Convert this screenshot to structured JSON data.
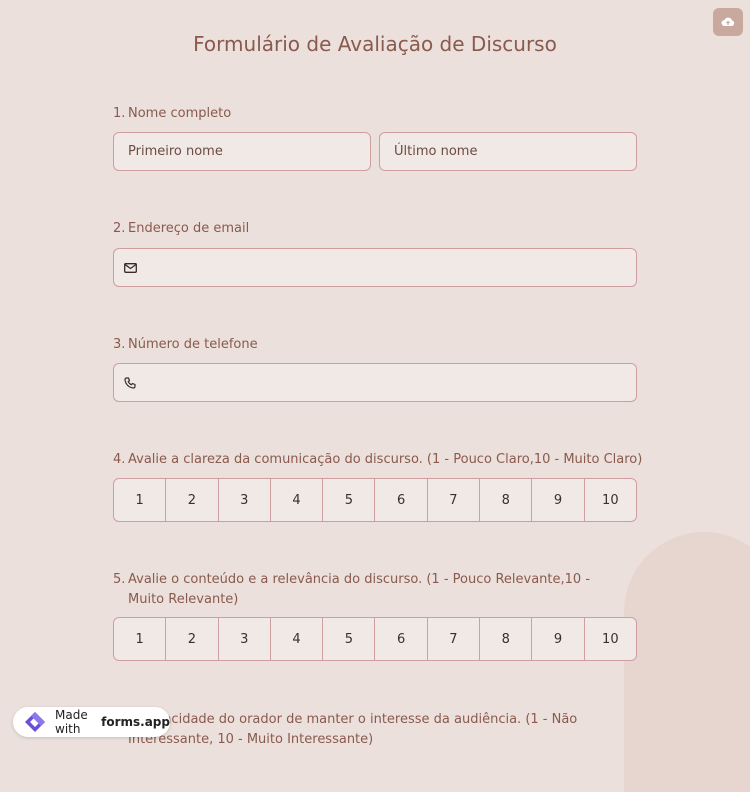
{
  "title": "Formulário de Avaliação de Discurso",
  "upload_icon": "cloud-upload-icon",
  "questions": {
    "q1": {
      "number": "1.",
      "label": "Nome completo",
      "first_placeholder": "Primeiro nome",
      "last_placeholder": "Último nome"
    },
    "q2": {
      "number": "2.",
      "label": "Endereço de email",
      "icon": "envelope-icon"
    },
    "q3": {
      "number": "3.",
      "label": "Número de telefone",
      "icon": "phone-icon"
    },
    "q4": {
      "number": "4.",
      "label": "Avalie a clareza da comunicação do discurso. (1 - Pouco Claro,10 - Muito Claro)",
      "options": [
        "1",
        "2",
        "3",
        "4",
        "5",
        "6",
        "7",
        "8",
        "9",
        "10"
      ]
    },
    "q5": {
      "number": "5.",
      "label": "Avalie o conteúdo e a relevância do discurso. (1 - Pouco Relevante,10 - Muito Relevante)",
      "options": [
        "1",
        "2",
        "3",
        "4",
        "5",
        "6",
        "7",
        "8",
        "9",
        "10"
      ]
    },
    "q6": {
      "number": "",
      "label": "a capacidade do orador de manter o interesse da audiência. (1 - Não Interessante, 10 - Muito Interessante)"
    }
  },
  "badge": {
    "prefix": "Made with",
    "brand": "forms.app"
  },
  "colors": {
    "background": "#ebe0db",
    "accent": "#8a5a4e",
    "border": "#cf9ea0",
    "field": "#f0e9e6"
  }
}
